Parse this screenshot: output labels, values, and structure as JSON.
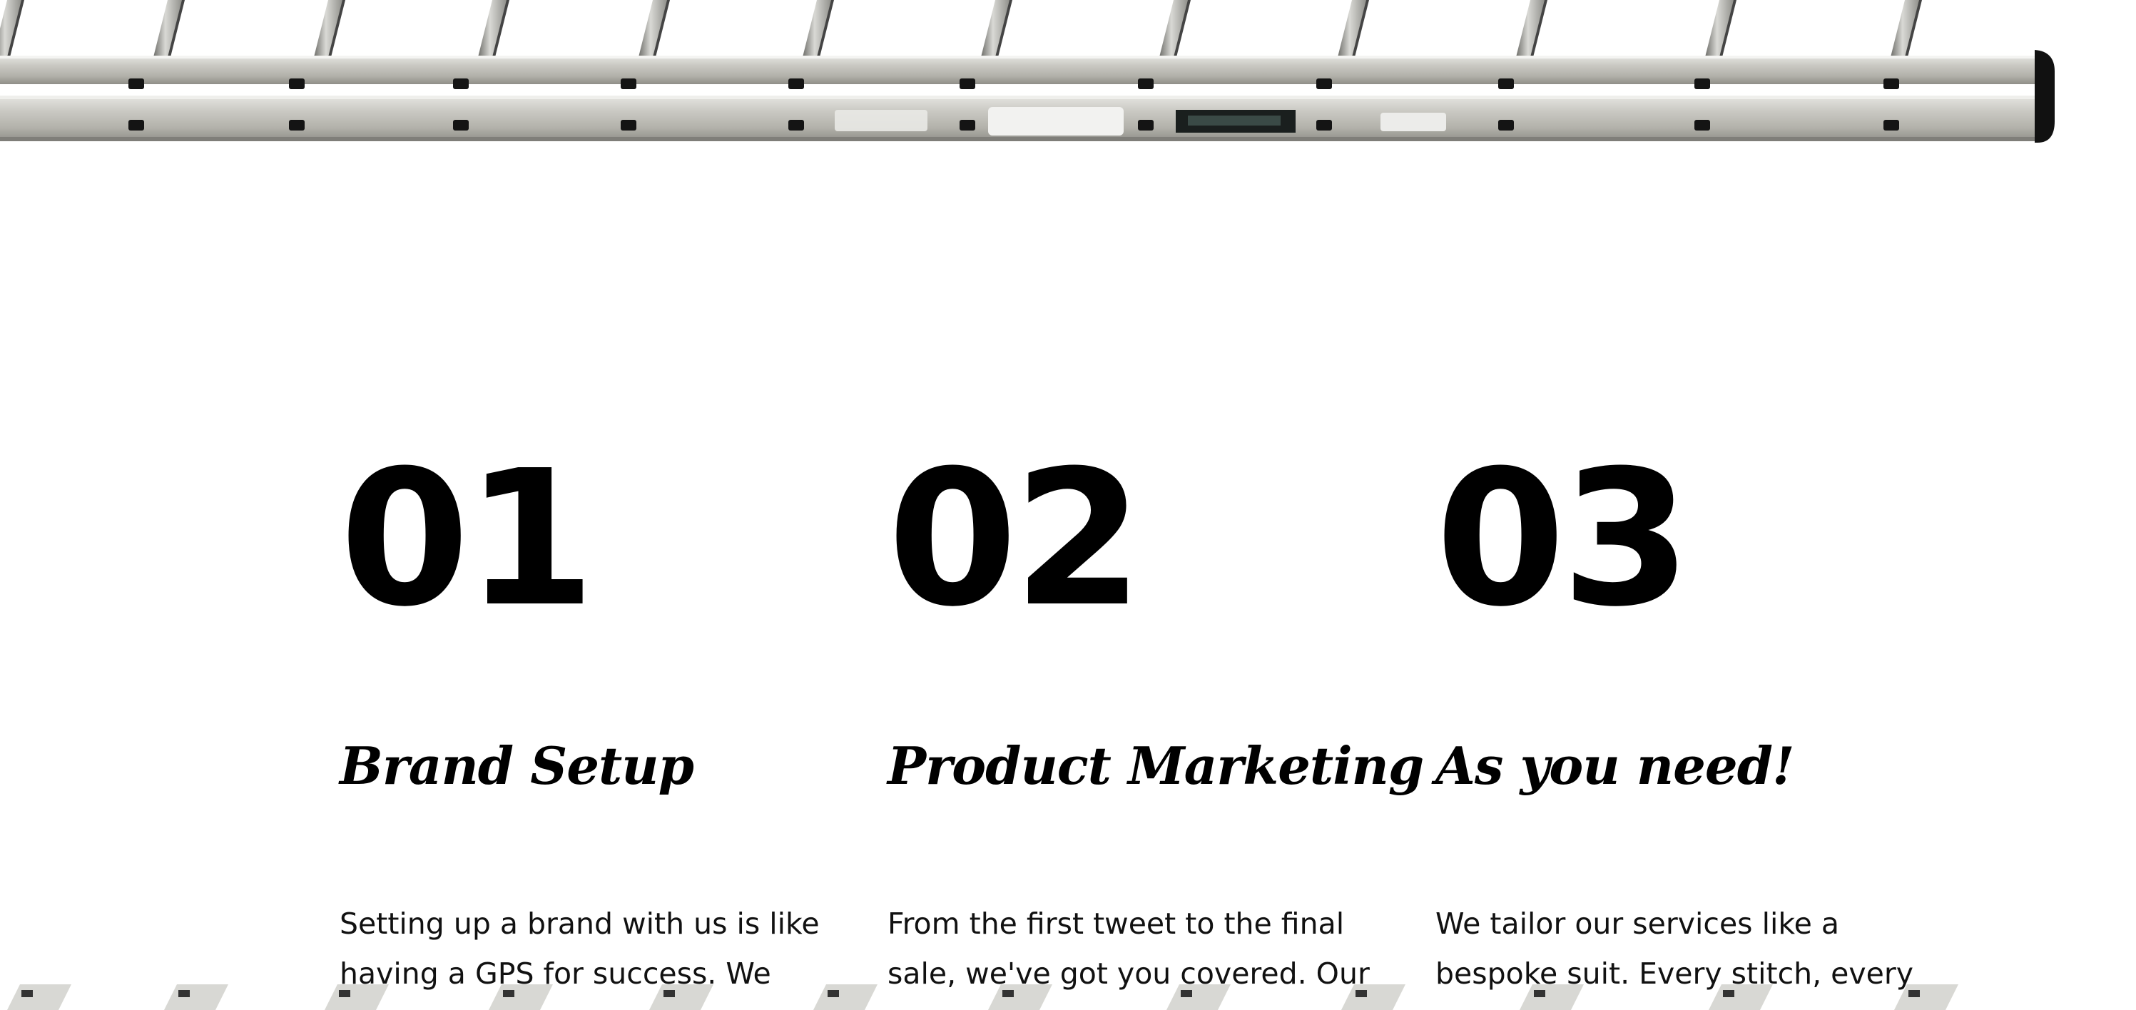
{
  "hero": {
    "image": "ladder-icon"
  },
  "steps": [
    {
      "number": "01",
      "title": "Brand Setup",
      "text": "Setting up a brand with us is like having a GPS for success. We"
    },
    {
      "number": "02",
      "title": "Product Marketing",
      "text": "From the first tweet to the final sale, we've got you covered. Our"
    },
    {
      "number": "03",
      "title": "As you need!",
      "text": "We tailor our services like a bespoke suit. Every stitch, every"
    }
  ]
}
